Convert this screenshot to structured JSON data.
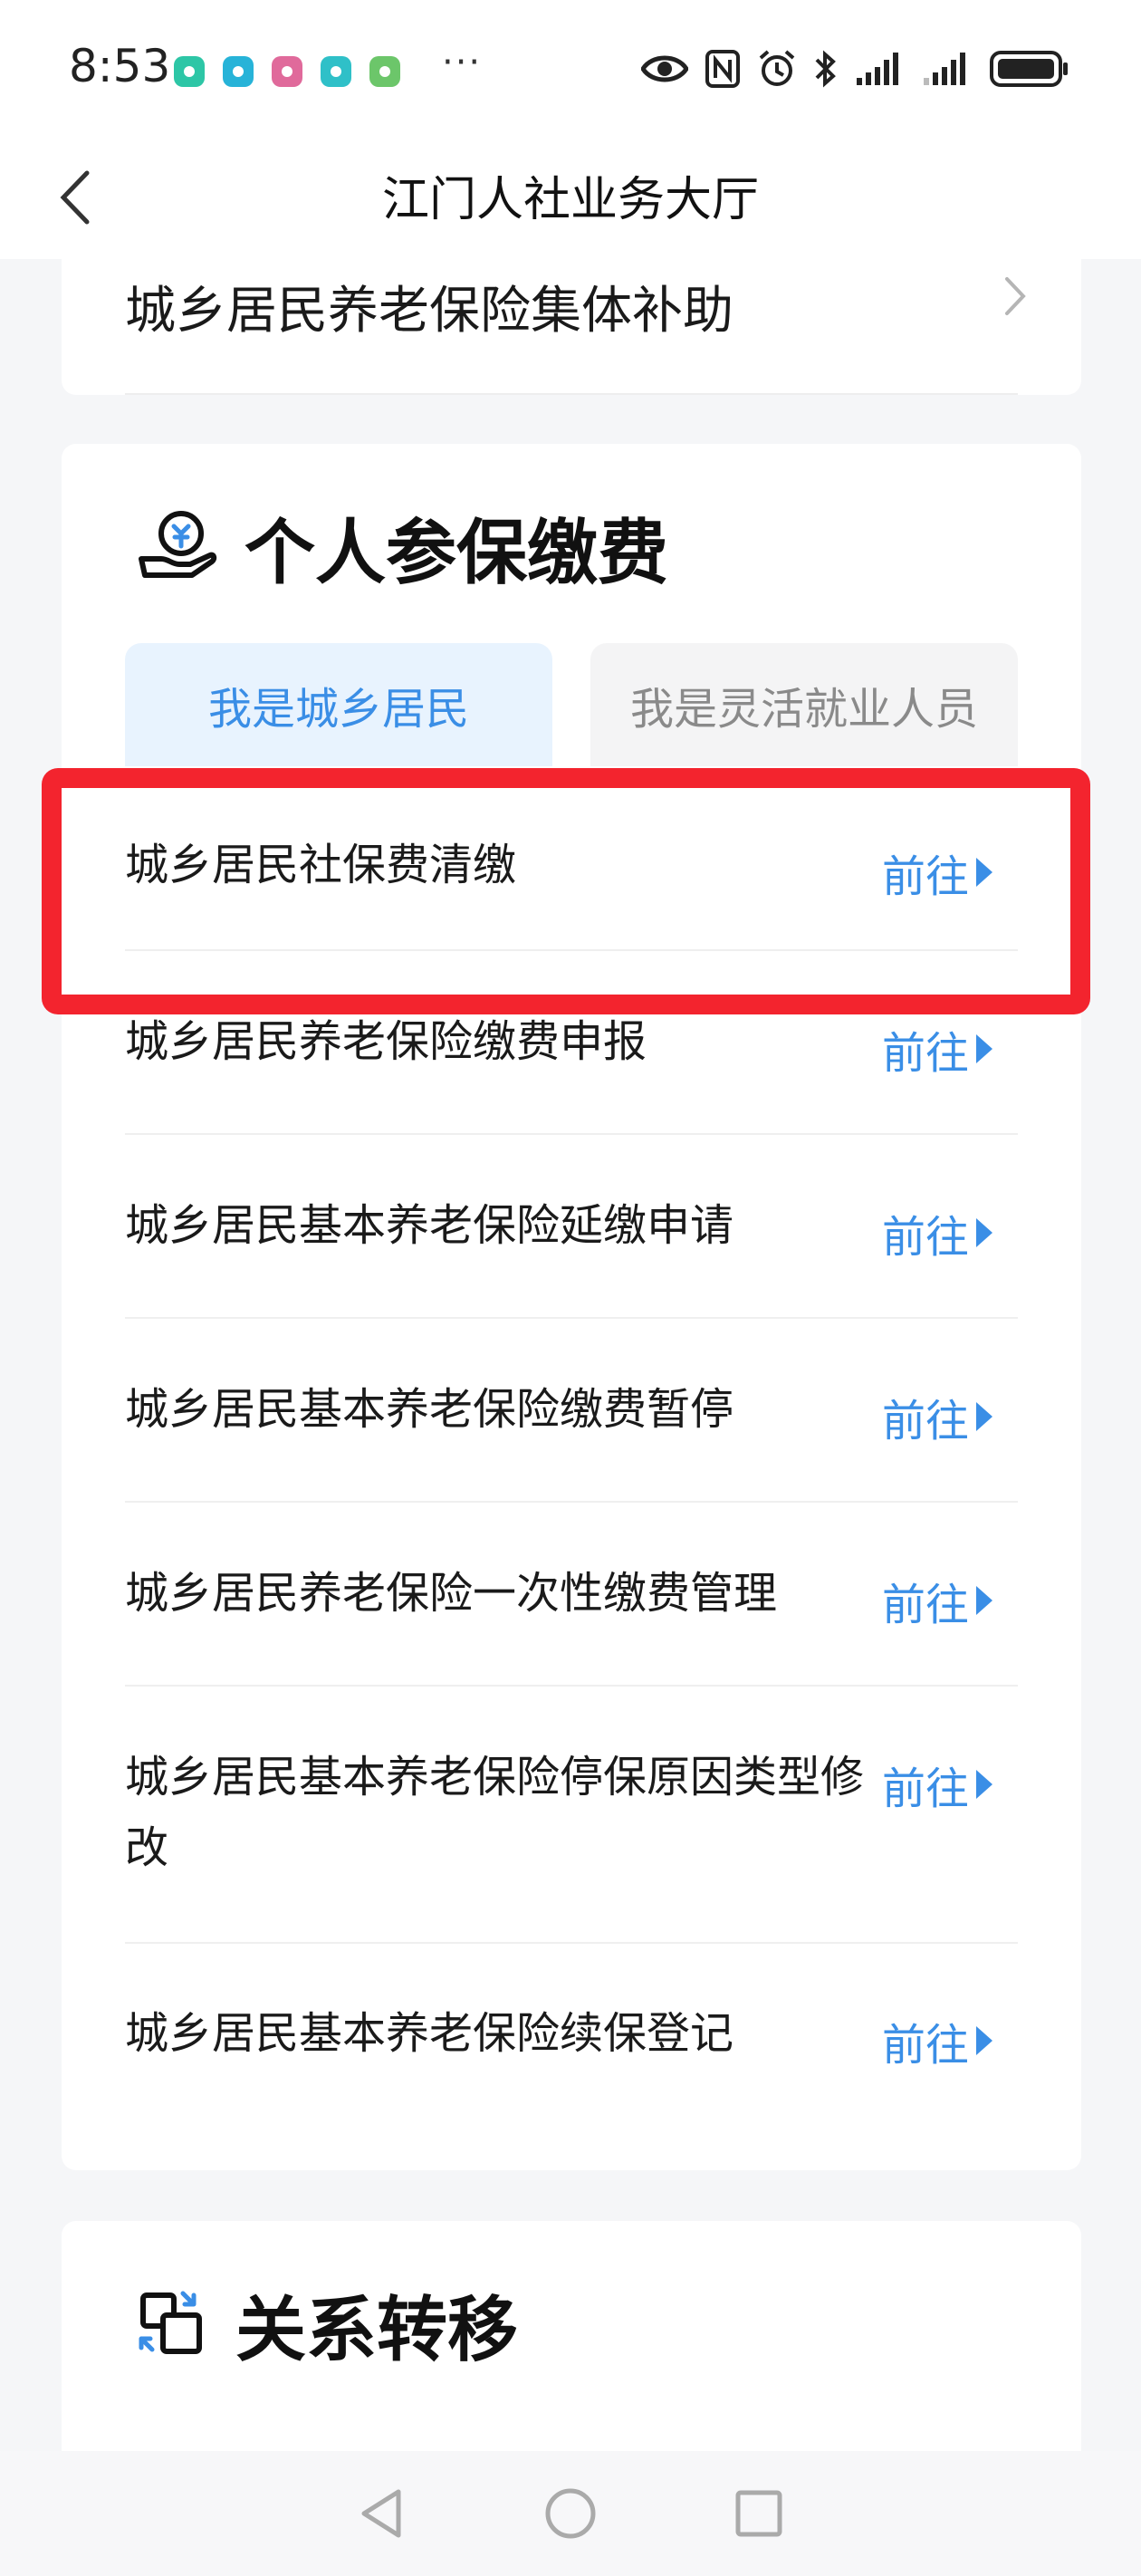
{
  "status_bar": {
    "time": "8:53",
    "notification_colors": [
      "#2dc6a6",
      "#27b3d8",
      "#e06a9b",
      "#2fc0c8",
      "#6cc66a"
    ],
    "more": "···",
    "system_icons": [
      "eye-icon",
      "nfc-icon",
      "alarm-icon",
      "bluetooth-icon",
      "signal-icon",
      "signal-icon",
      "battery-icon"
    ]
  },
  "nav": {
    "title": "江门人社业务大厅"
  },
  "top_card": {
    "item_label": "城乡居民养老保险集体补助"
  },
  "personal_section": {
    "title": "个人参保缴费",
    "tabs": [
      {
        "label": "我是城乡居民",
        "active": true
      },
      {
        "label": "我是灵活就业人员",
        "active": false
      }
    ],
    "items": [
      {
        "label": "城乡居民社保费清缴",
        "action": "前往"
      },
      {
        "label": "城乡居民养老保险缴费申报",
        "action": "前往"
      },
      {
        "label": "城乡居民基本养老保险延缴申请",
        "action": "前往"
      },
      {
        "label": "城乡居民基本养老保险缴费暂停",
        "action": "前往"
      },
      {
        "label": "城乡居民养老保险一次性缴费管理",
        "action": "前往"
      },
      {
        "label": "城乡居民基本养老保险停保原因类型修改",
        "action": "前往"
      },
      {
        "label": "城乡居民基本养老保险续保登记",
        "action": "前往"
      }
    ]
  },
  "transfer_section": {
    "title": "关系转移"
  },
  "colors": {
    "accent": "#3a8ee6",
    "highlight": "#f3242e"
  }
}
